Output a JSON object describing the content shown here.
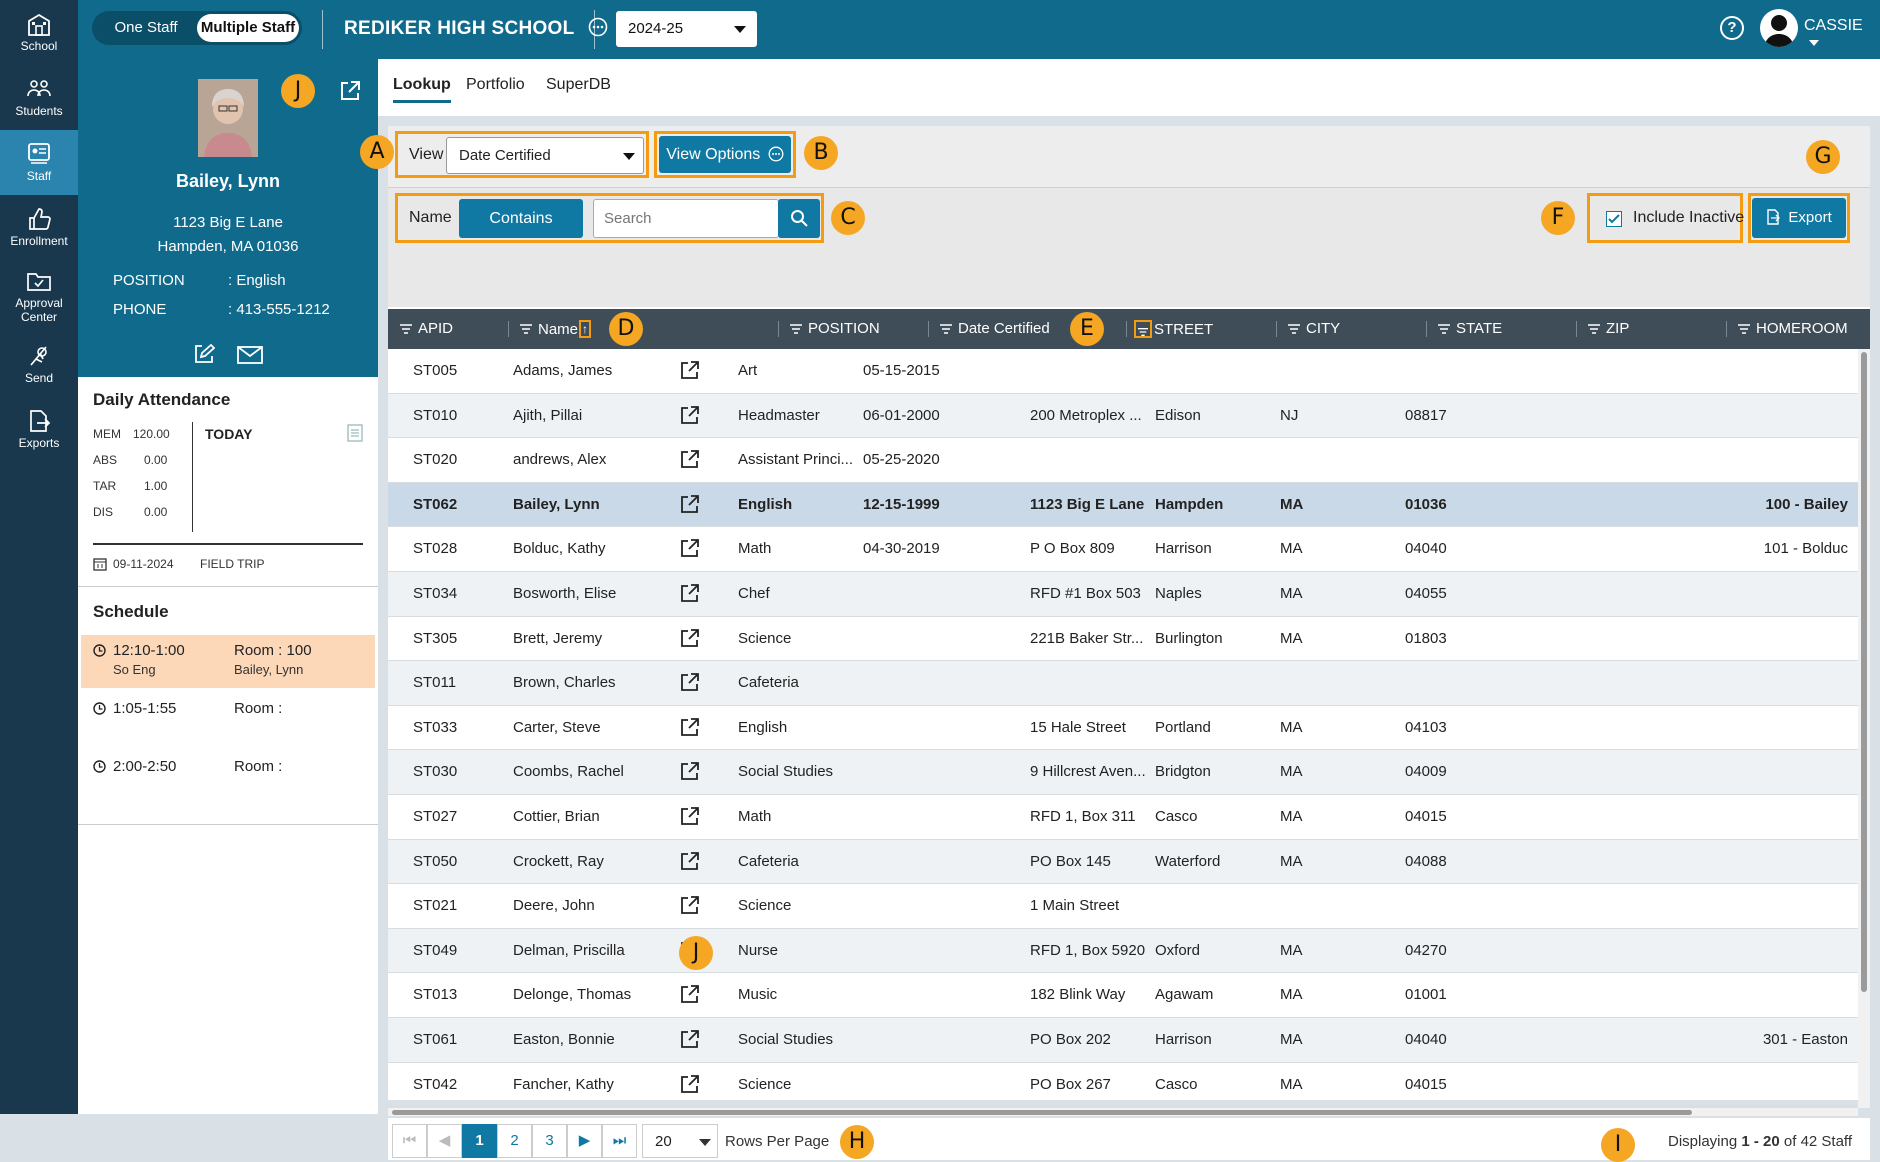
{
  "nav": [
    {
      "label": "School",
      "icon": "school-icon"
    },
    {
      "label": "Students",
      "icon": "students-icon"
    },
    {
      "label": "Staff",
      "icon": "staff-icon"
    },
    {
      "label": "Enrollment",
      "icon": "thumbs-up-icon"
    },
    {
      "label": "Approval Center",
      "icon": "folder-icon"
    },
    {
      "label": "Send",
      "icon": "send-icon"
    },
    {
      "label": "Exports",
      "icon": "export-icon"
    }
  ],
  "topbar": {
    "toggle_one": "One Staff",
    "toggle_multiple": "Multiple Staff",
    "school_name": "REDIKER HIGH SCHOOL",
    "year": "2024-25",
    "user": "CASSIE"
  },
  "profile": {
    "name": "Bailey, Lynn",
    "address1": "1123 Big E Lane",
    "address2": "Hampden, MA 01036",
    "position_label": "POSITION",
    "position_value": ": English",
    "phone_label": "PHONE",
    "phone_value": ": 413-555-1212"
  },
  "attendance": {
    "title": "Daily Attendance",
    "rows": [
      {
        "label": "MEM",
        "value": "120.00"
      },
      {
        "label": "ABS",
        "value": "0.00"
      },
      {
        "label": "TAR",
        "value": "1.00"
      },
      {
        "label": "DIS",
        "value": "0.00"
      }
    ],
    "today": "TODAY",
    "date": "09-11-2024",
    "event": "FIELD TRIP"
  },
  "schedule": {
    "title": "Schedule",
    "items": [
      {
        "time": "12:10-1:00",
        "course": "So Eng",
        "room": "Room : 100",
        "teacher": "Bailey, Lynn"
      },
      {
        "time": "1:05-1:55",
        "course": "",
        "room": "Room :",
        "teacher": ""
      },
      {
        "time": "2:00-2:50",
        "course": "",
        "room": "Room :",
        "teacher": ""
      }
    ]
  },
  "tabs": [
    "Lookup",
    "Portfolio",
    "SuperDB"
  ],
  "toolbar": {
    "view_label": "View",
    "view_value": "Date Certified",
    "view_options": "View Options",
    "name_label": "Name",
    "contains": "Contains",
    "search_placeholder": "Search",
    "include_inactive": "Include Inactive",
    "export": "Export"
  },
  "badges": {
    "a": "A",
    "b": "B",
    "c": "C",
    "d": "D",
    "e": "E",
    "f": "F",
    "g": "G",
    "h": "H",
    "i": "I",
    "j": "J"
  },
  "columns": [
    "APID",
    "Name",
    "POSITION",
    "Date Certified",
    "STREET",
    "CITY",
    "STATE",
    "ZIP",
    "HOMEROOM"
  ],
  "rows": [
    {
      "apid": "ST005",
      "name": "Adams, James",
      "position": "Art",
      "date": "05-15-2015",
      "street": "",
      "city": "",
      "state": "",
      "zip": "",
      "homeroom": ""
    },
    {
      "apid": "ST010",
      "name": "Ajith, Pillai",
      "position": "Headmaster",
      "date": "06-01-2000",
      "street": "200 Metroplex ...",
      "city": "Edison",
      "state": "NJ",
      "zip": "08817",
      "homeroom": ""
    },
    {
      "apid": "ST020",
      "name": "andrews, Alex",
      "position": "Assistant Princi...",
      "date": "05-25-2020",
      "street": "",
      "city": "",
      "state": "",
      "zip": "",
      "homeroom": ""
    },
    {
      "apid": "ST062",
      "name": "Bailey, Lynn",
      "position": "English",
      "date": "12-15-1999",
      "street": "1123 Big E Lane",
      "city": "Hampden",
      "state": "MA",
      "zip": "01036",
      "homeroom": "100 - Bailey"
    },
    {
      "apid": "ST028",
      "name": "Bolduc, Kathy",
      "position": "Math",
      "date": "04-30-2019",
      "street": "P O Box 809",
      "city": "Harrison",
      "state": "MA",
      "zip": "04040",
      "homeroom": "101 - Bolduc"
    },
    {
      "apid": "ST034",
      "name": "Bosworth, Elise",
      "position": "Chef",
      "date": "",
      "street": "RFD #1 Box 503",
      "city": "Naples",
      "state": "MA",
      "zip": "04055",
      "homeroom": ""
    },
    {
      "apid": "ST305",
      "name": "Brett, Jeremy",
      "position": "Science",
      "date": "",
      "street": "221B Baker Str...",
      "city": "Burlington",
      "state": "MA",
      "zip": "01803",
      "homeroom": ""
    },
    {
      "apid": "ST011",
      "name": "Brown, Charles",
      "position": "Cafeteria",
      "date": "",
      "street": "",
      "city": "",
      "state": "",
      "zip": "",
      "homeroom": ""
    },
    {
      "apid": "ST033",
      "name": "Carter, Steve",
      "position": "English",
      "date": "",
      "street": "15 Hale Street",
      "city": "Portland",
      "state": "MA",
      "zip": "04103",
      "homeroom": ""
    },
    {
      "apid": "ST030",
      "name": "Coombs, Rachel",
      "position": "Social Studies",
      "date": "",
      "street": "9 Hillcrest Aven...",
      "city": "Bridgton",
      "state": "MA",
      "zip": "04009",
      "homeroom": ""
    },
    {
      "apid": "ST027",
      "name": "Cottier, Brian",
      "position": "Math",
      "date": "",
      "street": "RFD 1, Box 311",
      "city": "Casco",
      "state": "MA",
      "zip": "04015",
      "homeroom": ""
    },
    {
      "apid": "ST050",
      "name": "Crockett, Ray",
      "position": "Cafeteria",
      "date": "",
      "street": "PO Box 145",
      "city": "Waterford",
      "state": "MA",
      "zip": "04088",
      "homeroom": ""
    },
    {
      "apid": "ST021",
      "name": "Deere, John",
      "position": "Science",
      "date": "",
      "street": "1 Main Street",
      "city": "",
      "state": "",
      "zip": "",
      "homeroom": ""
    },
    {
      "apid": "ST049",
      "name": "Delman, Priscilla",
      "position": "Nurse",
      "date": "",
      "street": "RFD 1, Box 5920",
      "city": "Oxford",
      "state": "MA",
      "zip": "04270",
      "homeroom": ""
    },
    {
      "apid": "ST013",
      "name": "Delonge, Thomas",
      "position": "Music",
      "date": "",
      "street": "182 Blink Way",
      "city": "Agawam",
      "state": "MA",
      "zip": "01001",
      "homeroom": ""
    },
    {
      "apid": "ST061",
      "name": "Easton, Bonnie",
      "position": "Social Studies",
      "date": "",
      "street": "PO Box 202",
      "city": "Harrison",
      "state": "MA",
      "zip": "04040",
      "homeroom": "301 - Easton"
    },
    {
      "apid": "ST042",
      "name": "Fancher, Kathy",
      "position": "Science",
      "date": "",
      "street": "PO Box 267",
      "city": "Casco",
      "state": "MA",
      "zip": "04015",
      "homeroom": ""
    }
  ],
  "pager": {
    "pages": [
      "1",
      "2",
      "3"
    ],
    "rows_per_page": "20",
    "rows_per_page_label": "Rows Per Page",
    "display_prefix": "Displaying",
    "display_range": "1 - 20",
    "display_suffix": "of 42 Staff"
  },
  "colors": {
    "accent": "#0f6a8c",
    "nav": "#19384d",
    "highlight": "#f39c12",
    "selected_row": "#c9d9e8"
  }
}
